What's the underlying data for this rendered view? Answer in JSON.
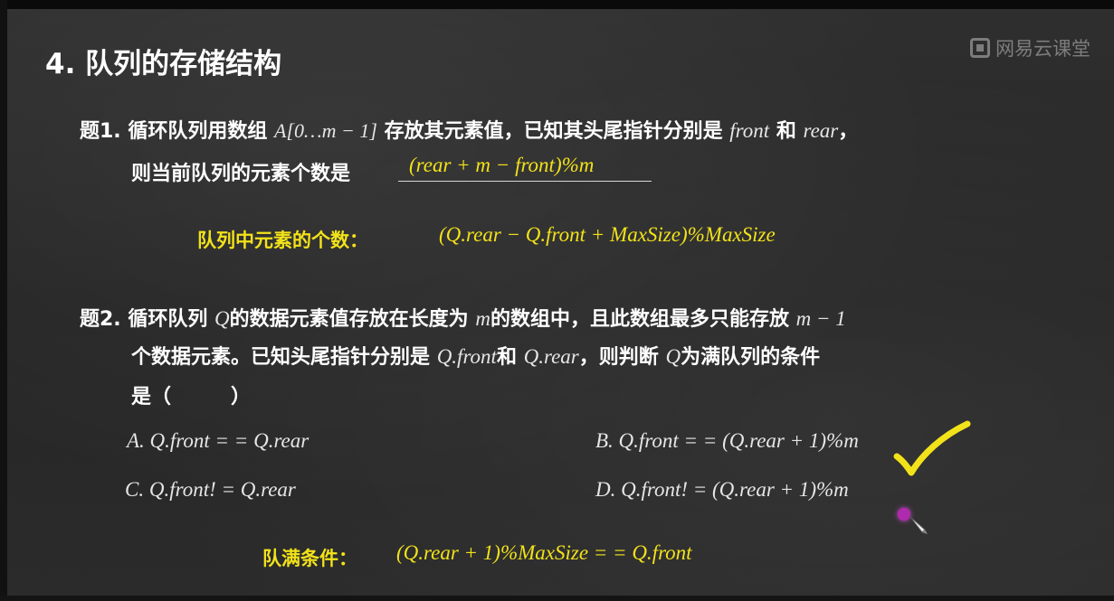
{
  "watermark": {
    "text": "网易云课堂",
    "icon": "cloud-classroom-logo-icon"
  },
  "title": "4. 队列的存储结构",
  "q1": {
    "label": "题1.",
    "line1_a": "循环队列用数组",
    "line1_array": "A[0…m − 1]",
    "line1_b": "存放其元素值，已知其头尾指针分别是",
    "front": "front",
    "and": "和",
    "rear": "rear",
    "comma": "，",
    "line2": "则当前队列的元素个数是",
    "answer": "(rear + m − front)%m"
  },
  "formula1": {
    "label": "队列中元素的个数：",
    "expr": "(Q.rear − Q.front + MaxSize)%MaxSize"
  },
  "q2": {
    "label": "题2.",
    "line1_a": "循环队列",
    "Q": "Q",
    "line1_b": "的数据元素值存放在长度为",
    "m": "m",
    "line1_c": "的数组中，且此数组最多只能存放",
    "m_minus_1": "m − 1",
    "line2_a": "个数据元素。已知头尾指针分别是",
    "qfront": "Q.front",
    "and": "和",
    "qrear": "Q.rear",
    "line2_b": "，则判断",
    "line2_c": "为满队列的条件",
    "line3": "是（　　　）",
    "options": {
      "A": "A. Q.front = = Q.rear",
      "B": "B. Q.front = = (Q.rear + 1)%m",
      "C": "C. Q.front! = Q.rear",
      "D": "D. Q.front! = (Q.rear + 1)%m"
    }
  },
  "formula2": {
    "label": "队满条件：",
    "expr": "(Q.rear + 1)%MaxSize = = Q.front"
  },
  "annotations": {
    "check_color": "#f2e21a",
    "cursor_color": "#b02ab0",
    "check_icon": "checkmark-icon",
    "cursor_icon": "pen-cursor-icon"
  }
}
